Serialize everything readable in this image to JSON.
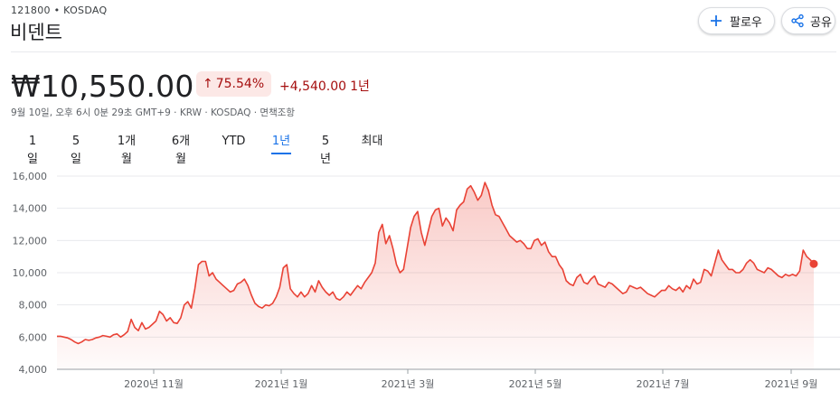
{
  "header": {
    "ticker": "121800 • KOSDAQ",
    "company": "비덴트",
    "follow_label": "팔로우",
    "share_label": "공유"
  },
  "quote": {
    "price": "₩10,550.00",
    "change_percent": "75.54%",
    "change_amount": "+4,540.00",
    "change_period": "1년",
    "meta": "9월 10일, 오후 6시 0분 29초 GMT+9 · KRW · KOSDAQ · 면책조항"
  },
  "tabs": [
    {
      "label": "1일",
      "active": false
    },
    {
      "label": "5일",
      "active": false
    },
    {
      "label": "1개월",
      "active": false
    },
    {
      "label": "6개월",
      "active": false
    },
    {
      "label": "YTD",
      "active": false
    },
    {
      "label": "1년",
      "active": true
    },
    {
      "label": "5년",
      "active": false
    },
    {
      "label": "최대",
      "active": false
    }
  ],
  "colors": {
    "line": "#e94235",
    "accent": "#1a73e8",
    "negative_text": "#a50e0e",
    "badge_bg": "#fce8e6"
  },
  "chart_data": {
    "type": "area",
    "ylim": [
      4000,
      16000
    ],
    "yticks": [
      "16,000",
      "14,000",
      "12,000",
      "10,000",
      "8,000",
      "6,000",
      "4,000"
    ],
    "xticks": [
      "2020년 11월",
      "2021년 1월",
      "2021년 3월",
      "2021년 5월",
      "2021년 7월",
      "2021년 9월"
    ],
    "grid": true,
    "series": [
      {
        "values": [
          6050,
          6050,
          6000,
          5950,
          5850,
          5700,
          5600,
          5700,
          5850,
          5800,
          5850,
          5950,
          6000,
          6100,
          6050,
          6000,
          6150,
          6200,
          6000,
          6150,
          6350,
          7100,
          6600,
          6400,
          6900,
          6500,
          6600,
          6800,
          7000,
          7600,
          7400,
          7000,
          7200,
          6900,
          6850,
          7200,
          8000,
          8200,
          7800,
          9000,
          10500,
          10700,
          10700,
          9800,
          10000,
          9600,
          9400,
          9200,
          9000,
          8800,
          8900,
          9300,
          9400,
          9600,
          9200,
          8600,
          8100,
          7900,
          7800,
          8000,
          7950,
          8100,
          8500,
          9100,
          10300,
          10500,
          9000,
          8700,
          8500,
          8800,
          8500,
          8700,
          9200,
          8800,
          9500,
          9100,
          8800,
          8600,
          8800,
          8400,
          8300,
          8500,
          8800,
          8600,
          8900,
          9200,
          9000,
          9400,
          9700,
          10000,
          10600,
          12500,
          13000,
          11800,
          12300,
          11500,
          10500,
          10000,
          10200,
          11500,
          12800,
          13500,
          13800,
          12500,
          11700,
          12600,
          13500,
          13900,
          14000,
          12900,
          13400,
          13100,
          12600,
          13900,
          14200,
          14400,
          15200,
          15400,
          15000,
          14500,
          14800,
          15600,
          15100,
          14200,
          13600,
          13500,
          13100,
          12700,
          12300,
          12100,
          11900,
          12000,
          11800,
          11500,
          11500,
          12000,
          12100,
          11700,
          11900,
          11300,
          11000,
          11000,
          10500,
          10200,
          9500,
          9300,
          9200,
          9700,
          9900,
          9400,
          9300,
          9600,
          9800,
          9300,
          9200,
          9100,
          9400,
          9300,
          9100,
          8900,
          8700,
          8800,
          9200,
          9100,
          9000,
          9100,
          8900,
          8700,
          8600,
          8500,
          8700,
          8900,
          8900,
          9200,
          9000,
          8900,
          9100,
          8800,
          9200,
          9000,
          9600,
          9300,
          9400,
          10200,
          10100,
          9800,
          10600,
          11400,
          10800,
          10500,
          10200,
          10200,
          10000,
          10000,
          10200,
          10600,
          10800,
          10600,
          10200,
          10100,
          10000,
          10300,
          10200,
          10000,
          9800,
          9700,
          9900,
          9800,
          9900,
          9800,
          10100,
          11400,
          11000,
          10800,
          10550
        ]
      }
    ]
  }
}
